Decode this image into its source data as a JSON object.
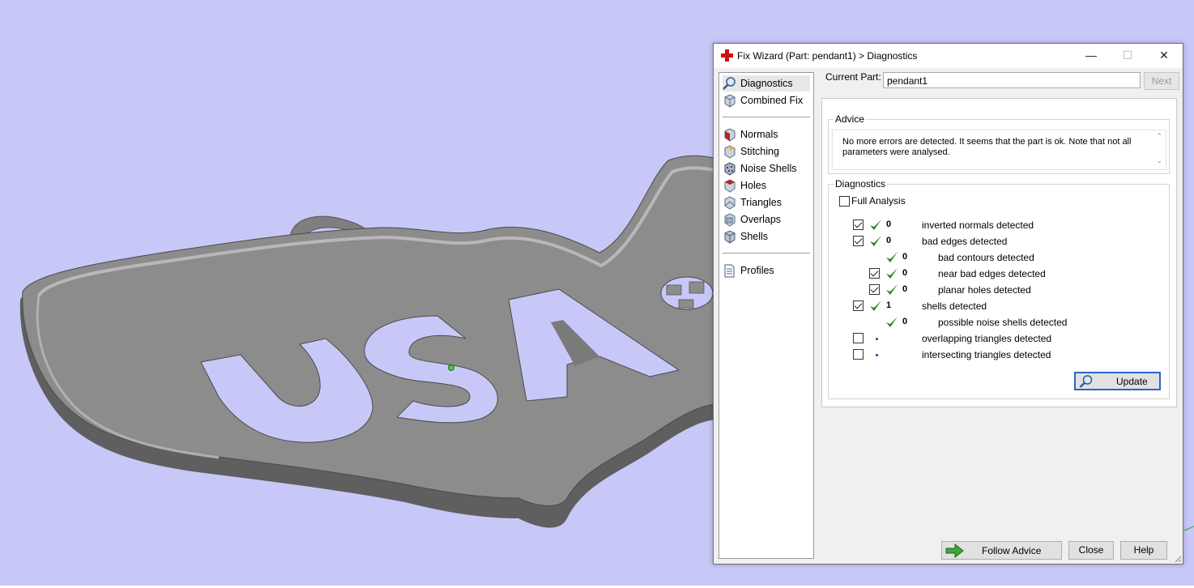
{
  "window": {
    "title": "Fix Wizard (Part: pendant1) > Diagnostics",
    "minimize_glyph": "—",
    "maximize_glyph": "☐",
    "close_glyph": "✕"
  },
  "sidebar": {
    "items": [
      {
        "label": "Diagnostics",
        "icon": "magnifier-icon",
        "selected": true
      },
      {
        "label": "Combined Fix",
        "icon": "cube-icon"
      },
      {
        "label": "Normals",
        "icon": "normals-cube-icon"
      },
      {
        "label": "Stitching",
        "icon": "stitching-icon"
      },
      {
        "label": "Noise Shells",
        "icon": "noise-shells-icon"
      },
      {
        "label": "Holes",
        "icon": "holes-cube-icon"
      },
      {
        "label": "Triangles",
        "icon": "triangles-icon"
      },
      {
        "label": "Overlaps",
        "icon": "overlaps-icon"
      },
      {
        "label": "Shells",
        "icon": "shells-icon"
      },
      {
        "label": "Profiles",
        "icon": "document-icon"
      }
    ]
  },
  "header": {
    "current_part_label": "Current Part:",
    "current_part_value": "pendant1",
    "next_label": "Next"
  },
  "advice": {
    "title": "Advice",
    "text": "No more errors are detected. It seems that the part is ok. Note that not all parameters were analysed."
  },
  "diagnostics": {
    "title": "Diagnostics",
    "full_analysis_label": "Full Analysis",
    "full_analysis_checked": false,
    "rows": [
      {
        "checkbox": true,
        "checked": true,
        "status": "ok",
        "count": "0",
        "label": "inverted normals detected",
        "indent": 0
      },
      {
        "checkbox": true,
        "checked": true,
        "status": "ok",
        "count": "0",
        "label": "bad edges detected",
        "indent": 0
      },
      {
        "checkbox": false,
        "checked": false,
        "status": "ok",
        "count": "0",
        "label": "bad contours detected",
        "indent": 1
      },
      {
        "checkbox": true,
        "checked": true,
        "status": "ok",
        "count": "0",
        "label": "near bad edges detected",
        "indent": 1
      },
      {
        "checkbox": true,
        "checked": true,
        "status": "ok",
        "count": "0",
        "label": "planar holes detected",
        "indent": 1
      },
      {
        "checkbox": true,
        "checked": true,
        "status": "ok",
        "count": "1",
        "label": "shells detected",
        "indent": 0
      },
      {
        "checkbox": false,
        "checked": false,
        "status": "ok",
        "count": "0",
        "label": "possible noise shells detected",
        "indent": 1
      },
      {
        "checkbox": true,
        "checked": false,
        "status": "dot",
        "count": "",
        "label": "overlapping triangles detected",
        "indent": 0
      },
      {
        "checkbox": true,
        "checked": false,
        "status": "dot",
        "count": "",
        "label": "intersecting triangles detected",
        "indent": 0
      }
    ],
    "update_label": "Update"
  },
  "footer": {
    "follow_advice_label": "Follow Advice",
    "close_label": "Close",
    "help_label": "Help"
  },
  "model": {
    "lettering": "USA"
  },
  "colors": {
    "viewport_background": "#c8c8f8",
    "model_gray": "#8a8a8a",
    "check_green": "#1f8a1f",
    "accent_red": "#d01010",
    "arrow_green": "#3aa83a"
  }
}
